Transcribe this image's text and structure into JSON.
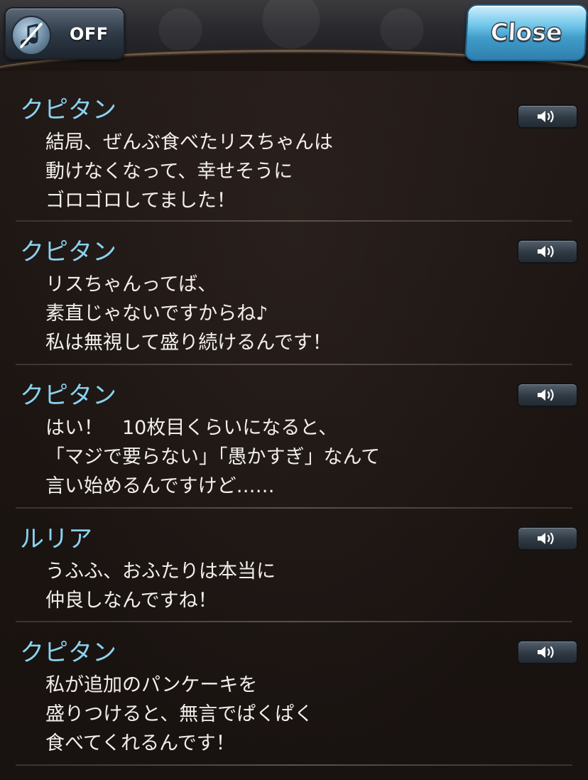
{
  "header": {
    "sound_label": "OFF",
    "close_label": "Close"
  },
  "log": [
    {
      "speaker": "クピタン",
      "lines": [
        "結局、ぜんぶ食べたリスちゃんは",
        "動けなくなって、幸せそうに",
        "ゴロゴロしてました！"
      ]
    },
    {
      "speaker": "クピタン",
      "lines": [
        "リスちゃんってば、",
        "素直じゃないですからね♪",
        "私は無視して盛り続けるんです！"
      ]
    },
    {
      "speaker": "クピタン",
      "lines": [
        "はい！　10枚目くらいになると、",
        "「マジで要らない」「愚かすぎ」なんて",
        "言い始めるんですけど……"
      ]
    },
    {
      "speaker": "ルリア",
      "lines": [
        "うふふ、おふたりは本当に",
        "仲良しなんですね！"
      ]
    },
    {
      "speaker": "クピタン",
      "lines": [
        "私が追加のパンケーキを",
        "盛りつけると、無言でぱくぱく",
        "食べてくれるんです！"
      ]
    }
  ],
  "colors": {
    "speaker": "#8ad3f1",
    "text": "#f2efeb",
    "background": "#1b1411",
    "close_button": "#5bb6de"
  },
  "icons": {
    "sound_toggle": "music-note-muted-icon",
    "voice_play": "speaker-play-icon"
  }
}
